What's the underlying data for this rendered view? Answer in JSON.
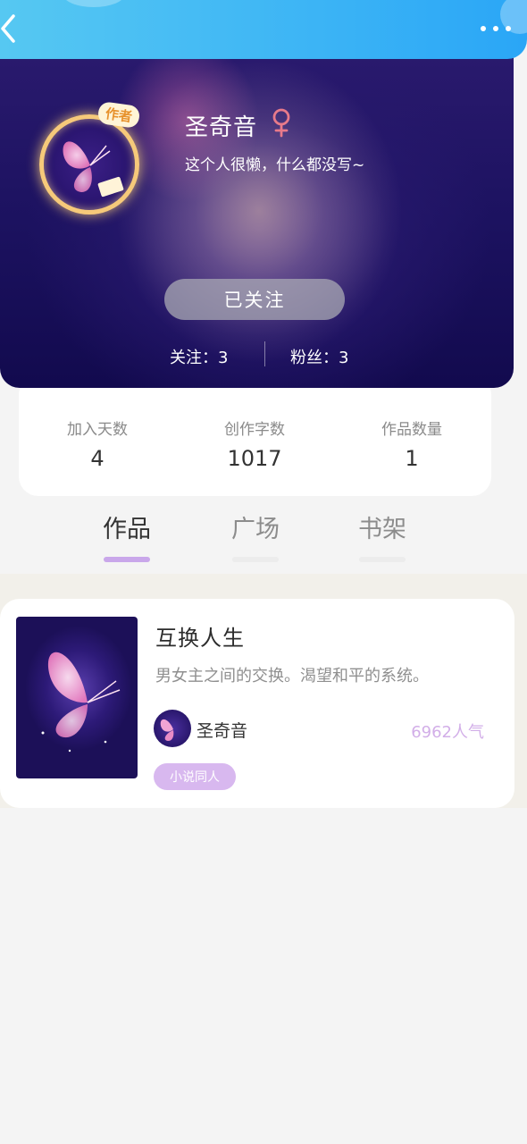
{
  "header": {
    "back_icon": "chevron-left-icon",
    "more_icon": "more-horizontal-icon"
  },
  "profile": {
    "avatar_badge": "作者",
    "name": "圣奇音",
    "gender": "female",
    "gender_color": "#e87a8a",
    "bio": "这个人很懒，什么都没写~",
    "follow_label": "已关注",
    "following_text": "关注：3",
    "fans_text": "粉丝：3"
  },
  "stats": [
    {
      "label": "加入天数",
      "value": "4"
    },
    {
      "label": "创作字数",
      "value": "1017"
    },
    {
      "label": "作品数量",
      "value": "1"
    }
  ],
  "tabs": [
    {
      "label": "作品",
      "active": true
    },
    {
      "label": "广场",
      "active": false
    },
    {
      "label": "书架",
      "active": false
    }
  ],
  "works": [
    {
      "title": "互换人生",
      "description": "男女主之间的交换。渴望和平的系统。",
      "author": "圣奇音",
      "popularity": "6962人气",
      "tag": "小说同人"
    }
  ],
  "colors": {
    "topbar": "#3cb4f5",
    "accent_purple": "#c9a7ea",
    "popularity": "#d2aee8"
  }
}
